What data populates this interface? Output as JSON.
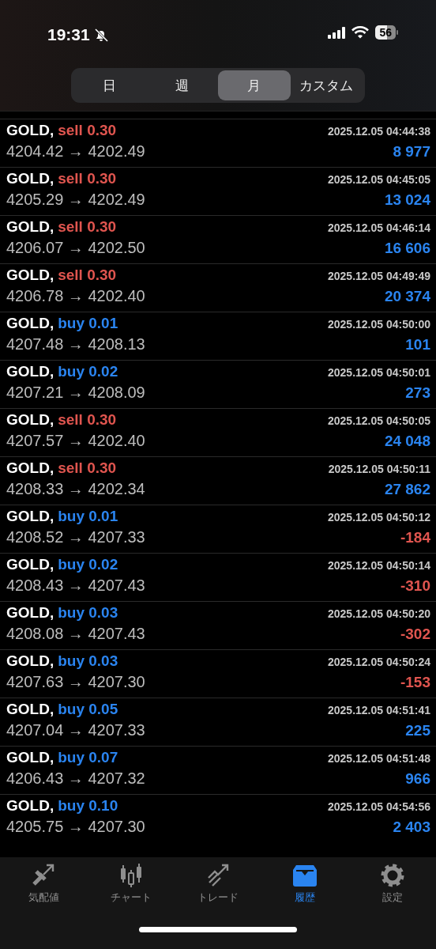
{
  "status_bar": {
    "time": "19:31",
    "silent": true,
    "battery": "56"
  },
  "period_tabs": [
    {
      "label": "日",
      "selected": false
    },
    {
      "label": "週",
      "selected": false
    },
    {
      "label": "月",
      "selected": true
    },
    {
      "label": "カスタム",
      "selected": false
    }
  ],
  "deals": [
    {
      "symbol": "GOLD,",
      "kind": "sell",
      "order": "sell 0.30",
      "time": "2025.12.05 04:44:38",
      "prices": "4204.42 → 4202.49",
      "color": "#2a84f0",
      "amount": "8 977"
    },
    {
      "symbol": "GOLD,",
      "kind": "sell",
      "order": "sell 0.30",
      "time": "2025.12.05 04:45:05",
      "prices": "4205.29 → 4202.49",
      "color": "#2a84f0",
      "amount": "13 024"
    },
    {
      "symbol": "GOLD,",
      "kind": "sell",
      "order": "sell 0.30",
      "time": "2025.12.05 04:46:14",
      "prices": "4206.07 → 4202.50",
      "color": "#2a84f0",
      "amount": "16 606"
    },
    {
      "symbol": "GOLD,",
      "kind": "sell",
      "order": "sell 0.30",
      "time": "2025.12.05 04:49:49",
      "prices": "4206.78 → 4202.40",
      "color": "#2a84f0",
      "amount": "20 374"
    },
    {
      "symbol": "GOLD,",
      "kind": "buy",
      "order": "buy 0.01",
      "time": "2025.12.05 04:50:00",
      "prices": "4207.48 → 4208.13",
      "color": "#2a84f0",
      "amount": "101"
    },
    {
      "symbol": "GOLD,",
      "kind": "buy",
      "order": "buy 0.02",
      "time": "2025.12.05 04:50:01",
      "prices": "4207.21 → 4208.09",
      "color": "#2a84f0",
      "amount": "273"
    },
    {
      "symbol": "GOLD,",
      "kind": "sell",
      "order": "sell 0.30",
      "time": "2025.12.05 04:50:05",
      "prices": "4207.57 → 4202.40",
      "color": "#2a84f0",
      "amount": "24 048"
    },
    {
      "symbol": "GOLD,",
      "kind": "sell",
      "order": "sell 0.30",
      "time": "2025.12.05 04:50:11",
      "prices": "4208.33 → 4202.34",
      "color": "#2a84f0",
      "amount": "27 862"
    },
    {
      "symbol": "GOLD,",
      "kind": "buy",
      "order": "buy 0.01",
      "time": "2025.12.05 04:50:12",
      "prices": "4208.52 → 4207.33",
      "color": "#e0554f",
      "amount": "-184"
    },
    {
      "symbol": "GOLD,",
      "kind": "buy",
      "order": "buy 0.02",
      "time": "2025.12.05 04:50:14",
      "prices": "4208.43 → 4207.43",
      "color": "#e0554f",
      "amount": "-310"
    },
    {
      "symbol": "GOLD,",
      "kind": "buy",
      "order": "buy 0.03",
      "time": "2025.12.05 04:50:20",
      "prices": "4208.08 → 4207.43",
      "color": "#e0554f",
      "amount": "-302"
    },
    {
      "symbol": "GOLD,",
      "kind": "buy",
      "order": "buy 0.03",
      "time": "2025.12.05 04:50:24",
      "prices": "4207.63 → 4207.30",
      "color": "#e0554f",
      "amount": "-153"
    },
    {
      "symbol": "GOLD,",
      "kind": "buy",
      "order": "buy 0.05",
      "time": "2025.12.05 04:51:41",
      "prices": "4207.04 → 4207.33",
      "color": "#2a84f0",
      "amount": "225"
    },
    {
      "symbol": "GOLD,",
      "kind": "buy",
      "order": "buy 0.07",
      "time": "2025.12.05 04:51:48",
      "prices": "4206.43 → 4207.32",
      "color": "#2a84f0",
      "amount": "966"
    },
    {
      "symbol": "GOLD,",
      "kind": "buy",
      "order": "buy 0.10",
      "time": "2025.12.05 04:54:56",
      "prices": "4205.75 → 4207.30",
      "color": "#2a84f0",
      "amount": "2 403"
    }
  ],
  "tab_bar": [
    {
      "kind": "quotes",
      "label": "気配値",
      "selected": false
    },
    {
      "kind": "chart",
      "label": "チャート",
      "selected": false
    },
    {
      "kind": "trade",
      "label": "トレード",
      "selected": false
    },
    {
      "kind": "history",
      "label": "履歴",
      "selected": true
    },
    {
      "kind": "settings",
      "label": "設定",
      "selected": false
    }
  ]
}
